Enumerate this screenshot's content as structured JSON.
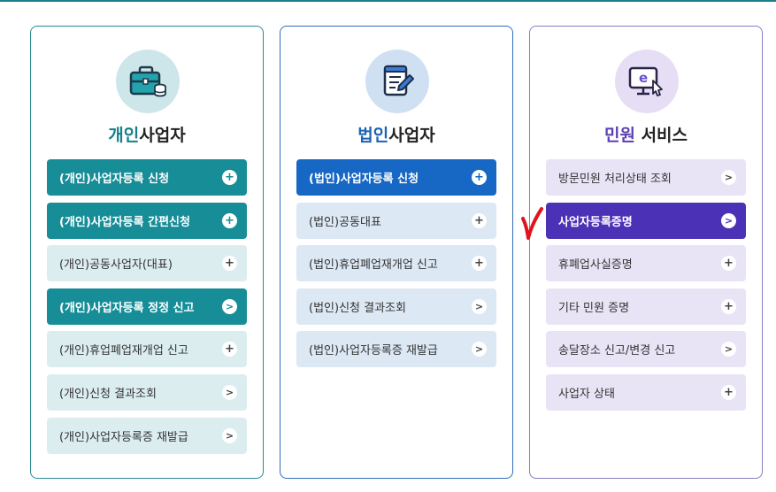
{
  "cards": [
    {
      "title_highlight": "개인",
      "title_rest": "사업자",
      "icon": "briefcase-coins-icon",
      "items": [
        {
          "label": "(개인)사업자등록 신청",
          "active": true,
          "icon": "plus"
        },
        {
          "label": "(개인)사업자등록 간편신청",
          "active": true,
          "icon": "plus"
        },
        {
          "label": "(개인)공동사업자(대표)",
          "active": false,
          "icon": "plus"
        },
        {
          "label": "(개인)사업자등록 정정 신고",
          "active": true,
          "icon": "chevron"
        },
        {
          "label": "(개인)휴업폐업재개업 신고",
          "active": false,
          "icon": "plus"
        },
        {
          "label": "(개인)신청 결과조회",
          "active": false,
          "icon": "chevron"
        },
        {
          "label": "(개인)사업자등록증 재발급",
          "active": false,
          "icon": "chevron"
        }
      ]
    },
    {
      "title_highlight": "법인",
      "title_rest": "사업자",
      "icon": "document-pen-icon",
      "items": [
        {
          "label": "(법인)사업자등록 신청",
          "active": true,
          "icon": "plus"
        },
        {
          "label": "(법인)공동대표",
          "active": false,
          "icon": "plus"
        },
        {
          "label": "(법인)휴업폐업재개업 신고",
          "active": false,
          "icon": "plus"
        },
        {
          "label": "(법인)신청 결과조회",
          "active": false,
          "icon": "chevron"
        },
        {
          "label": "(법인)사업자등록증 재발급",
          "active": false,
          "icon": "chevron"
        }
      ]
    },
    {
      "title_highlight": "민원",
      "title_rest": " 서비스",
      "icon": "monitor-e-icon",
      "items": [
        {
          "label": "방문민원 처리상태 조회",
          "active": false,
          "icon": "chevron"
        },
        {
          "label": "사업자등록증명",
          "active": true,
          "icon": "chevron"
        },
        {
          "label": "휴폐업사실증명",
          "active": false,
          "icon": "plus"
        },
        {
          "label": "기타 민원 증명",
          "active": false,
          "icon": "plus"
        },
        {
          "label": "송달장소 신고/변경 신고",
          "active": false,
          "icon": "chevron"
        },
        {
          "label": "사업자 상태",
          "active": false,
          "icon": "plus"
        }
      ]
    }
  ],
  "colors": {
    "teal": "#168d97",
    "blue": "#1767c4",
    "purple": "#4b31b5",
    "annotation": "#e0141e"
  }
}
